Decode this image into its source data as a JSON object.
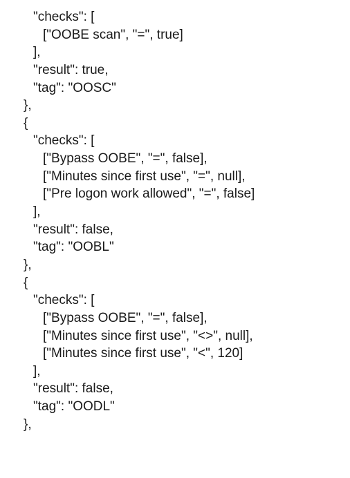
{
  "lines": [
    {
      "indent": 2,
      "text": "\"checks\": ["
    },
    {
      "indent": 3,
      "text": "[\"OOBE scan\", \"=\", true]"
    },
    {
      "indent": 2,
      "text": "],"
    },
    {
      "indent": 2,
      "text": "\"result\": true,"
    },
    {
      "indent": 2,
      "text": "\"tag\": \"OOSC\""
    },
    {
      "indent": 1,
      "text": "},"
    },
    {
      "indent": 1,
      "text": "{"
    },
    {
      "indent": 2,
      "text": "\"checks\": ["
    },
    {
      "indent": 3,
      "text": "[\"Bypass OOBE\", \"=\", false],"
    },
    {
      "indent": 3,
      "text": "[\"Minutes since first use\", \"=\", null],"
    },
    {
      "indent": 3,
      "text": "[\"Pre logon work allowed\", \"=\", false]"
    },
    {
      "indent": 2,
      "text": "],"
    },
    {
      "indent": 2,
      "text": "\"result\": false,"
    },
    {
      "indent": 2,
      "text": "\"tag\": \"OOBL\""
    },
    {
      "indent": 1,
      "text": "},"
    },
    {
      "indent": 1,
      "text": "{"
    },
    {
      "indent": 2,
      "text": "\"checks\": ["
    },
    {
      "indent": 3,
      "text": "[\"Bypass OOBE\", \"=\", false],"
    },
    {
      "indent": 3,
      "text": "[\"Minutes since first use\", \"<>\", null],"
    },
    {
      "indent": 3,
      "text": "[\"Minutes since first use\", \"<\", 120]"
    },
    {
      "indent": 2,
      "text": "],"
    },
    {
      "indent": 2,
      "text": "\"result\": false,"
    },
    {
      "indent": 2,
      "text": "\"tag\": \"OODL\""
    },
    {
      "indent": 1,
      "text": "},"
    }
  ],
  "source_objects": [
    {
      "checks": [
        [
          "OOBE scan",
          "=",
          true
        ]
      ],
      "result": true,
      "tag": "OOSC"
    },
    {
      "checks": [
        [
          "Bypass OOBE",
          "=",
          false
        ],
        [
          "Minutes since first use",
          "=",
          null
        ],
        [
          "Pre logon work allowed",
          "=",
          false
        ]
      ],
      "result": false,
      "tag": "OOBL"
    },
    {
      "checks": [
        [
          "Bypass OOBE",
          "=",
          false
        ],
        [
          "Minutes since first use",
          "<>",
          null
        ],
        [
          "Minutes since first use",
          "<",
          120
        ]
      ],
      "result": false,
      "tag": "OODL"
    }
  ]
}
